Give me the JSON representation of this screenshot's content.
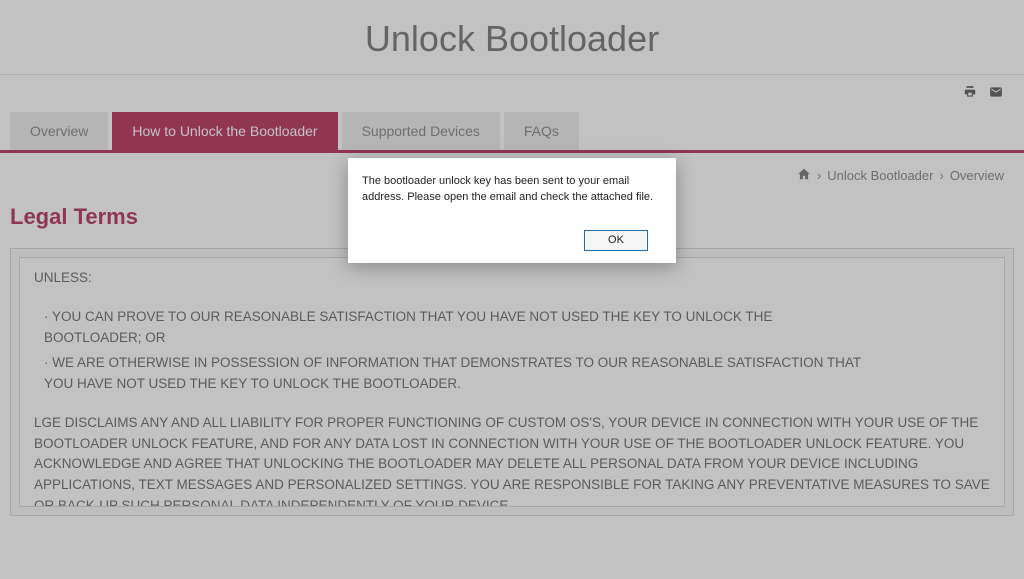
{
  "page": {
    "title": "Unlock Bootloader"
  },
  "tabs": [
    {
      "label": "Overview"
    },
    {
      "label": "How to Unlock the Bootloader"
    },
    {
      "label": "Supported Devices"
    },
    {
      "label": "FAQs"
    }
  ],
  "breadcrumb": {
    "sep1": "›",
    "item1": "Unlock Bootloader",
    "sep2": "›",
    "item2": "Overview"
  },
  "section": {
    "title": "Legal Terms"
  },
  "terms": {
    "l1": "UNLESS:",
    "l2": "· YOU CAN PROVE TO OUR REASONABLE SATISFACTION THAT YOU HAVE NOT USED THE KEY TO UNLOCK THE BOOTLOADER; OR",
    "l3": "· WE ARE OTHERWISE IN POSSESSION OF INFORMATION THAT DEMONSTRATES TO OUR REASONABLE SATISFACTION THAT YOU HAVE NOT USED THE KEY TO UNLOCK THE BOOTLOADER.",
    "l4": "LGE DISCLAIMS ANY AND ALL LIABILITY FOR PROPER FUNCTIONING OF CUSTOM OS'S, YOUR DEVICE IN CONNECTION WITH YOUR USE OF THE BOOTLOADER UNLOCK FEATURE, AND FOR ANY DATA LOST IN CONNECTION WITH YOUR USE OF THE BOOTLOADER UNLOCK FEATURE. YOU ACKNOWLEDGE AND AGREE THAT UNLOCKING THE BOOTLOADER MAY DELETE ALL PERSONAL DATA FROM YOUR DEVICE INCLUDING APPLICATIONS, TEXT MESSAGES AND PERSONALIZED SETTINGS.  YOU ARE RESPONSIBLE FOR TAKING ANY PREVENTATIVE MEASURES TO SAVE OR BACK-UP SUCH PERSONAL DATA INDEPENDENTLY OF YOUR DEVICE."
  },
  "modal": {
    "message": "The bootloader unlock key has been sent to your email address. Please open the email and check the attached file.",
    "ok": "OK"
  }
}
